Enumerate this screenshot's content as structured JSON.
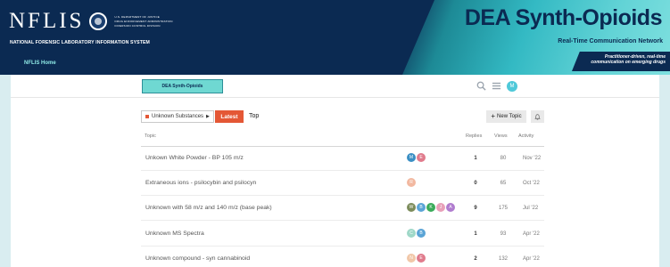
{
  "banner": {
    "nflis_wordmark": "NFLIS",
    "dea_lines": [
      "U.S. DEPARTMENT OF JUSTICE",
      "DRUG ENFORCEMENT ADMINISTRATION",
      "DIVERSION CONTROL DIVISION"
    ],
    "subtitle": "NATIONAL FORENSIC LABORATORY INFORMATION SYSTEM",
    "home_link": "NFLIS Home",
    "title": "DEA Synth-Opioids",
    "tagline": "Real-Time Communication Network",
    "strap_line1": "Practitioner-driven, real-time",
    "strap_line2": "communication on emerging drugs",
    "colors": {
      "navy": "#0b2a52",
      "teal": "#33b9c3",
      "accent": "#e45735"
    }
  },
  "header": {
    "forum_logo": "DEA Synth-Opioids",
    "search_icon": "search-icon",
    "menu_icon": "hamburger-menu-icon",
    "user_avatar": "M"
  },
  "nav": {
    "category": "Unknown Substances",
    "latest": "Latest",
    "top": "Top",
    "new_topic": "New Topic",
    "bell_icon": "bell-icon"
  },
  "table": {
    "headers": {
      "topic": "Topic",
      "replies": "Replies",
      "views": "Views",
      "activity": "Activity"
    },
    "rows": [
      {
        "title": "Unkown White Powder - BP 105 m/z",
        "posters": [
          {
            "letter": "M",
            "color": "#3b8fc4"
          },
          {
            "letter": "E",
            "color": "#e07b8c"
          }
        ],
        "replies": "1",
        "views": "80",
        "activity": "Nov '22"
      },
      {
        "title": "Extraneous ions - psilocybin and psilocyn",
        "posters": [
          {
            "letter": "R",
            "color": "#f2b8a0"
          }
        ],
        "replies": "0",
        "views": "65",
        "activity": "Oct '22"
      },
      {
        "title": "Unknown with 58 m/z and 140 m/z (base peak)",
        "posters": [
          {
            "letter": "W",
            "color": "#7c8c5b"
          },
          {
            "letter": "B",
            "color": "#5aa4d6"
          },
          {
            "letter": "K",
            "color": "#3bab5a"
          },
          {
            "letter": "J",
            "color": "#e8a0b8"
          },
          {
            "letter": "A",
            "color": "#b07ccf"
          }
        ],
        "replies": "9",
        "views": "175",
        "activity": "Jul '22"
      },
      {
        "title": "Unknown MS Spectra",
        "posters": [
          {
            "letter": "C",
            "color": "#9fd8c8"
          },
          {
            "letter": "B",
            "color": "#5aa4d6"
          }
        ],
        "replies": "1",
        "views": "93",
        "activity": "Apr '22"
      },
      {
        "title": "Unknown compound - syn cannabinoid",
        "posters": [
          {
            "letter": "N",
            "color": "#f1c7a8"
          },
          {
            "letter": "E",
            "color": "#e07b8c"
          }
        ],
        "replies": "2",
        "views": "132",
        "activity": "Apr '22"
      }
    ]
  }
}
